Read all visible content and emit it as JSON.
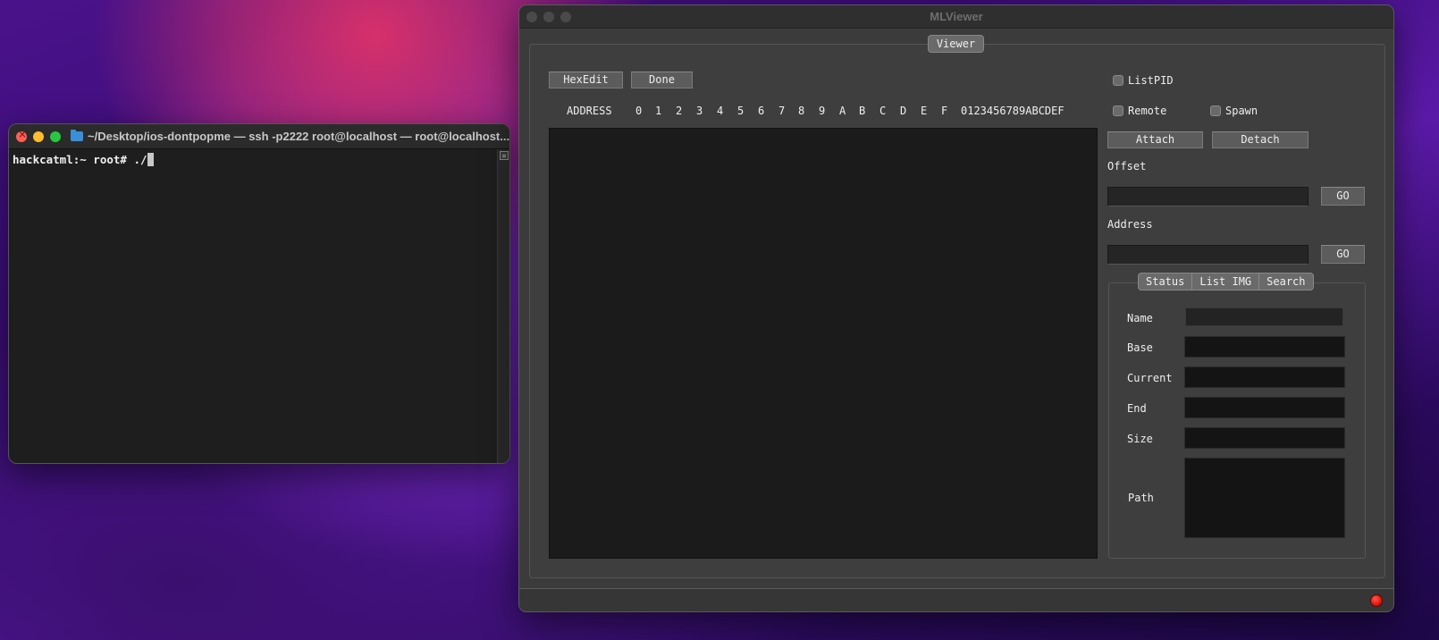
{
  "terminal": {
    "title": "~/Desktop/ios-dontpopme — ssh -p2222 root@localhost — root@localhost...",
    "prompt": "hackcatml:~ root# ./"
  },
  "mlviewer": {
    "title": "MLViewer",
    "tab": "Viewer",
    "buttons": {
      "hexedit": "HexEdit",
      "done": "Done",
      "attach": "Attach",
      "detach": "Detach",
      "go_offset": "GO",
      "go_address": "GO"
    },
    "checkboxes": {
      "listpid": "ListPID",
      "remote": "Remote",
      "spawn": "Spawn"
    },
    "hex_header": {
      "address": "ADDRESS",
      "columns": [
        "0",
        "1",
        "2",
        "3",
        "4",
        "5",
        "6",
        "7",
        "8",
        "9",
        "A",
        "B",
        "C",
        "D",
        "E",
        "F"
      ],
      "ascii": "0123456789ABCDEF"
    },
    "labels": {
      "offset": "Offset",
      "address": "Address"
    },
    "info_tabs": [
      "Status",
      "List IMG",
      "Search"
    ],
    "info_fields": {
      "name": "Name",
      "base": "Base",
      "current": "Current",
      "end": "End",
      "size": "Size",
      "path": "Path"
    },
    "status_color": "#e41b10"
  }
}
